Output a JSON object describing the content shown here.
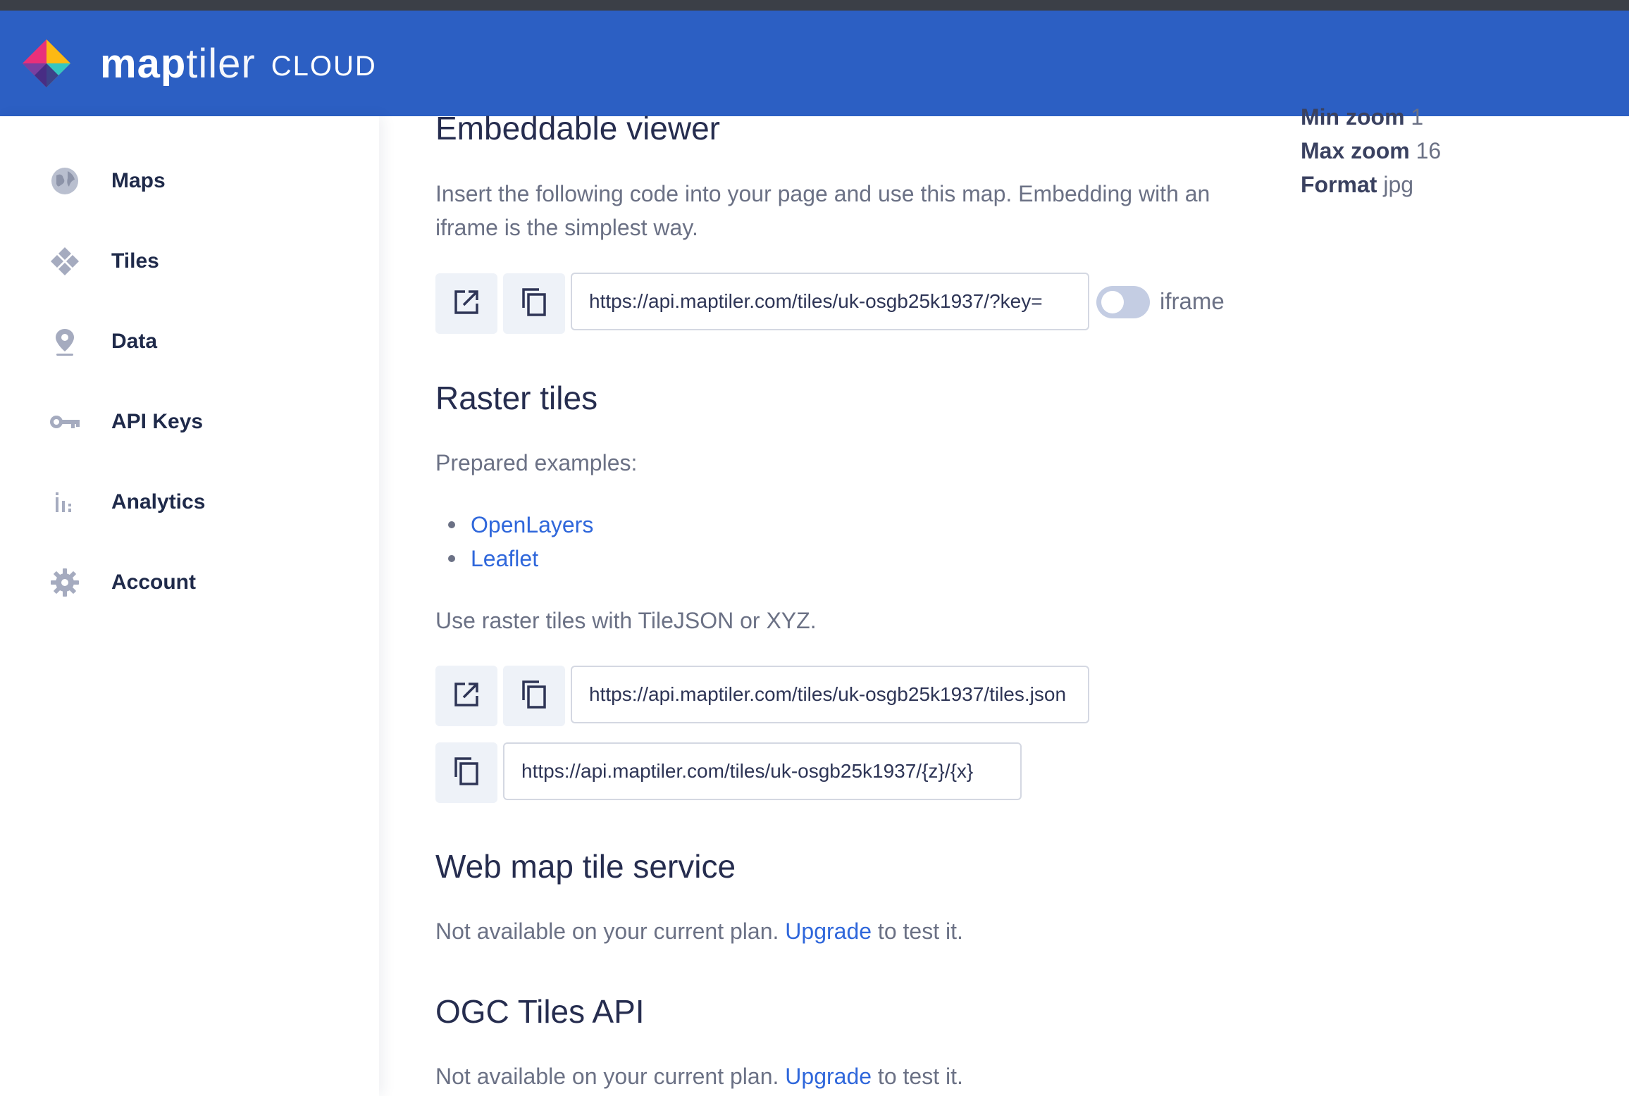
{
  "header": {
    "brand_name_bold": "map",
    "brand_name_light": "tiler",
    "brand_product": "CLOUD"
  },
  "sidebar": {
    "items": [
      {
        "label": "Maps",
        "icon": "globe-icon"
      },
      {
        "label": "Tiles",
        "icon": "tiles-icon"
      },
      {
        "label": "Data",
        "icon": "map-pin-icon"
      },
      {
        "label": "API Keys",
        "icon": "key-icon"
      },
      {
        "label": "Analytics",
        "icon": "bar-chart-icon"
      },
      {
        "label": "Account",
        "icon": "gear-icon"
      }
    ]
  },
  "meta": {
    "min_zoom_label": "Min zoom",
    "min_zoom_value": "1",
    "max_zoom_label": "Max zoom",
    "max_zoom_value": "16",
    "format_label": "Format",
    "format_value": "jpg"
  },
  "embeddable": {
    "title": "Embeddable viewer",
    "description_line1": "Insert the following code into your page and use this map. Embedding with an",
    "description_line2": "iframe is the simplest way.",
    "url": "https://api.maptiler.com/tiles/uk-osgb25k1937/?key=",
    "toggle_label": "iframe",
    "toggle_on": false
  },
  "raster": {
    "title": "Raster tiles",
    "prepared": "Prepared examples:",
    "examples": [
      "OpenLayers",
      "Leaflet"
    ],
    "use_text": "Use raster tiles with TileJSON or XYZ.",
    "tilejson_url": "https://api.maptiler.com/tiles/uk-osgb25k1937/tiles.json",
    "xyz_url": "https://api.maptiler.com/tiles/uk-osgb25k1937/{z}/{x}"
  },
  "wmts": {
    "title": "Web map tile service",
    "text_before": "Not available on your current plan.",
    "link": "Upgrade",
    "text_after": "to test it."
  },
  "ogc": {
    "title": "OGC Tiles API",
    "text_before": "Not available on your current plan.",
    "link": "Upgrade",
    "text_after": "to test it."
  },
  "colors": {
    "header": "#2c5fc3",
    "link": "#2f67db",
    "icon": "#9aa0b8"
  }
}
